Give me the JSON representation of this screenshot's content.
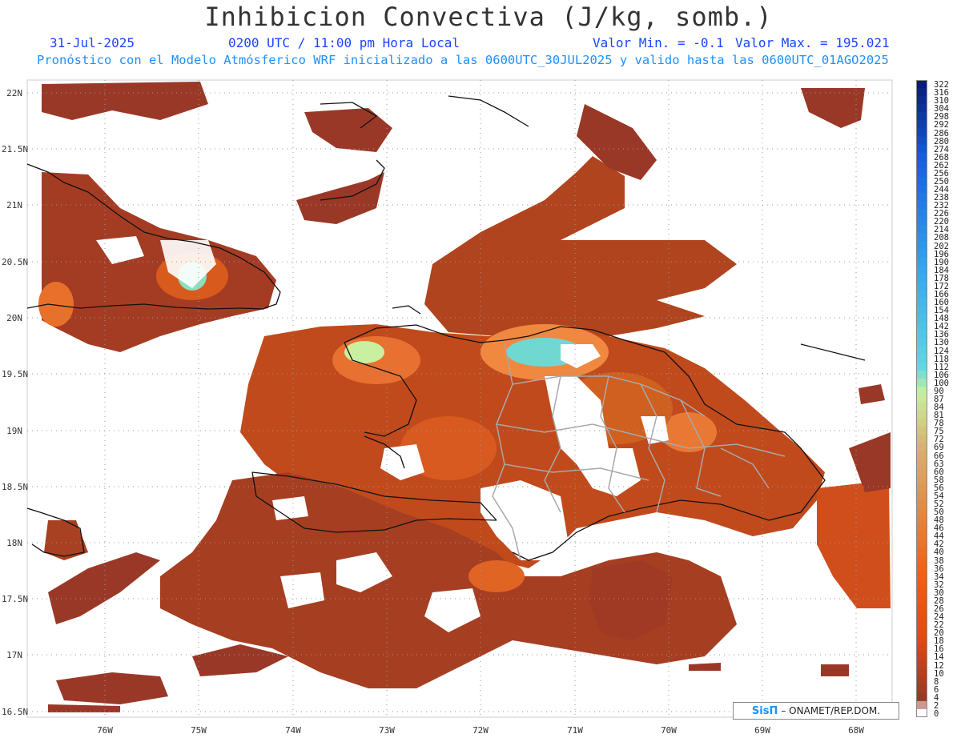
{
  "header": {
    "title": "Inhibicion Convectiva (J/kg, somb.)",
    "date": "31-Jul-2025",
    "time": "0200 UTC / 11:00 pm Hora Local",
    "value_min": "Valor Min. = -0.1",
    "value_max": "Valor Max. = 195.021",
    "model_line": "Pronóstico con el Modelo Atmósferico WRF inicializado a las 0600UTC_30JUL2025 y valido hasta las  0600UTC_01AGO2025"
  },
  "axes": {
    "lat_labels": [
      "22N",
      "21.5N",
      "21N",
      "20.5N",
      "20N",
      "19.5N",
      "19N",
      "18.5N",
      "18N",
      "17.5N",
      "17N",
      "16.5N"
    ],
    "lon_labels": [
      "76W",
      "75W",
      "74W",
      "73W",
      "72W",
      "71W",
      "70W",
      "69W",
      "68W"
    ]
  },
  "colorbar": {
    "labels": [
      "322",
      "316",
      "310",
      "304",
      "298",
      "292",
      "286",
      "280",
      "274",
      "268",
      "262",
      "256",
      "250",
      "244",
      "238",
      "232",
      "226",
      "220",
      "214",
      "208",
      "202",
      "196",
      "190",
      "184",
      "178",
      "172",
      "166",
      "160",
      "154",
      "148",
      "142",
      "136",
      "130",
      "124",
      "118",
      "112",
      "106",
      "100",
      "90",
      "87",
      "84",
      "81",
      "78",
      "75",
      "72",
      "69",
      "66",
      "63",
      "60",
      "58",
      "56",
      "54",
      "52",
      "50",
      "48",
      "46",
      "44",
      "42",
      "40",
      "38",
      "36",
      "34",
      "32",
      "30",
      "28",
      "26",
      "24",
      "22",
      "20",
      "18",
      "16",
      "14",
      "12",
      "10",
      "8",
      "6",
      "4",
      "2",
      "0"
    ],
    "colors": {
      "deep_blue": "#0a1a7a",
      "blue": "#1560e0",
      "light_blue": "#36a8f0",
      "cyan": "#5fd8e0",
      "pale_green": "#c8f0a0",
      "tan": "#d8b070",
      "orange": "#f06010",
      "red_orange": "#e04a10",
      "brown": "#9a3828",
      "zero": "#ffffff"
    }
  },
  "credit": {
    "brand": "SisΠ",
    "text": "– ONAMET/REP.DOM."
  }
}
